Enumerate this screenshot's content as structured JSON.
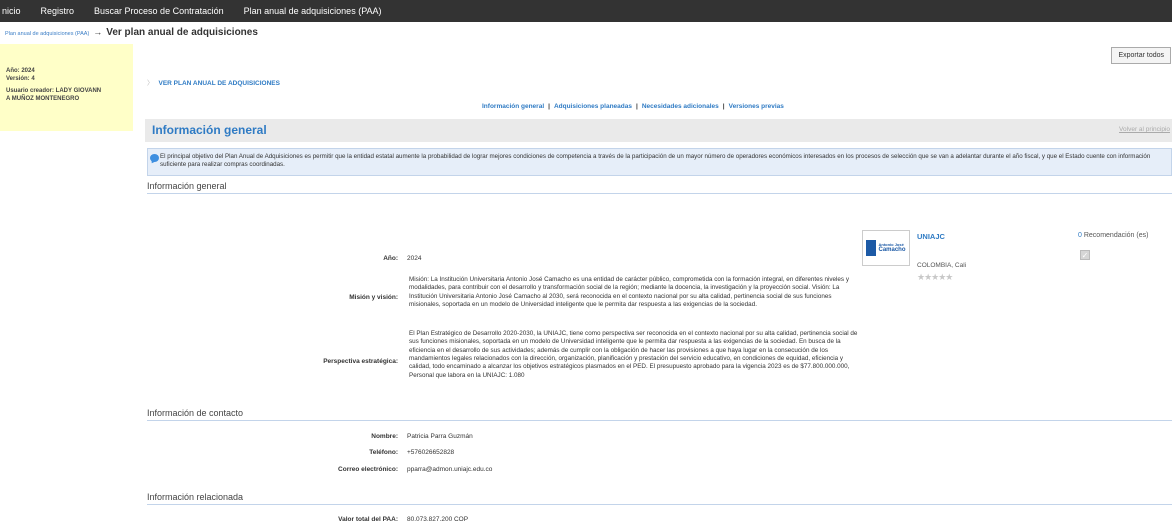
{
  "topnav": {
    "items": [
      "nicio",
      "Registro",
      "Buscar Proceso de Contratación",
      "Plan anual de adquisiciones (PAA)"
    ]
  },
  "breadcrumb": {
    "link": "Plan anual de adquisiciones (PAA)",
    "arrow": "→",
    "title": "Ver plan anual de adquisiciones"
  },
  "export_button": "Exportar todos",
  "infobox": {
    "year": "Año: 2024",
    "version": "Versión: 4",
    "creator_line1": "Usuario creador: LADY GIOVANN",
    "creator_line2": "A MUÑOZ MONTENEGRO"
  },
  "ver_plan": "VER PLAN ANUAL DE ADQUISICIONES",
  "tabs": [
    "Información general",
    "Adquisiciones planeadas",
    "Necesidades adicionales",
    "Versiones previas"
  ],
  "tab_separator": "|",
  "section": {
    "title": "Información general",
    "back_link": "Volver al principio"
  },
  "notice": {
    "text": "El principal objetivo del Plan Anual de Adquisiciones es permitir que la entidad estatal aumente la probabilidad de lograr mejores condiciones de competencia a través de la participación de un mayor número de operadores económicos interesados en los procesos de selección que se van a adelantar durante el año fiscal, y que el Estado cuente con información suficiente para realizar compras coordinadas."
  },
  "general": {
    "heading": "Información general",
    "year_label": "Año:",
    "year_value": "2024",
    "mission_label": "Misión y visión:",
    "mission_text": "Misión: La Institución Universitaria Antonio José Camacho es una entidad de carácter público, comprometida con la formación integral, en diferentes niveles y modalidades, para contribuir con el desarrollo y transformación social de la región; mediante la docencia, la investigación y la proyección social. Visión: La Institución Universitaria Antonio José Camacho al 2030, será reconocida en el contexto nacional por su alta calidad, pertinencia social de sus funciones misionales, soportada en un modelo de Universidad inteligente que le permita dar respuesta a las exigencias de la sociedad.",
    "strategy_label": "Perspectiva estratégica:",
    "strategy_text": "El Plan Estratégico de Desarrollo 2020-2030, la UNIAJC, tiene como perspectiva ser reconocida en el contexto nacional por su alta calidad, pertinencia social de sus funciones misionales, soportada en un modelo de Universidad inteligente que le permita dar respuesta a las exigencias de la sociedad. En busca de la eficiencia en el desarrollo de sus actividades; además de cumplir con la obligación de hacer las provisiones a que haya lugar en la consecución de los mandamientos legales relacionados con la dirección, organización, planificación y prestación del servicio educativo, en condiciones de equidad, eficiencia y calidad, todo encaminado a alcanzar los objetivos estratégicos plasmados en el PED. El presupuesto aprobado para la vigencia 2023 es de $77.800.000.000, Personal que labora en la UNIAJC: 1.080"
  },
  "entity": {
    "logo_line1": "Antonio José",
    "logo_line2": "Camacho",
    "name": "UNIAJC",
    "location": "COLOMBIA, Cali",
    "stars": "★★★★★",
    "rating": 0,
    "recommendations_count": "0",
    "recommendations_label": "Recomendación (es)",
    "check_icon": "✓"
  },
  "contact": {
    "heading": "Información de contacto",
    "name_label": "Nombre:",
    "name_value": "Patricia Parra Guzmán",
    "phone_label": "Teléfono:",
    "phone_value": "+576026652828",
    "email_label": "Correo electrónico:",
    "email_value": "pparra@admon.uniajc.edu.co"
  },
  "related": {
    "heading": "Información relacionada",
    "total_label": "Valor total del PAA:",
    "total_value": "80.073.827.200 COP"
  }
}
